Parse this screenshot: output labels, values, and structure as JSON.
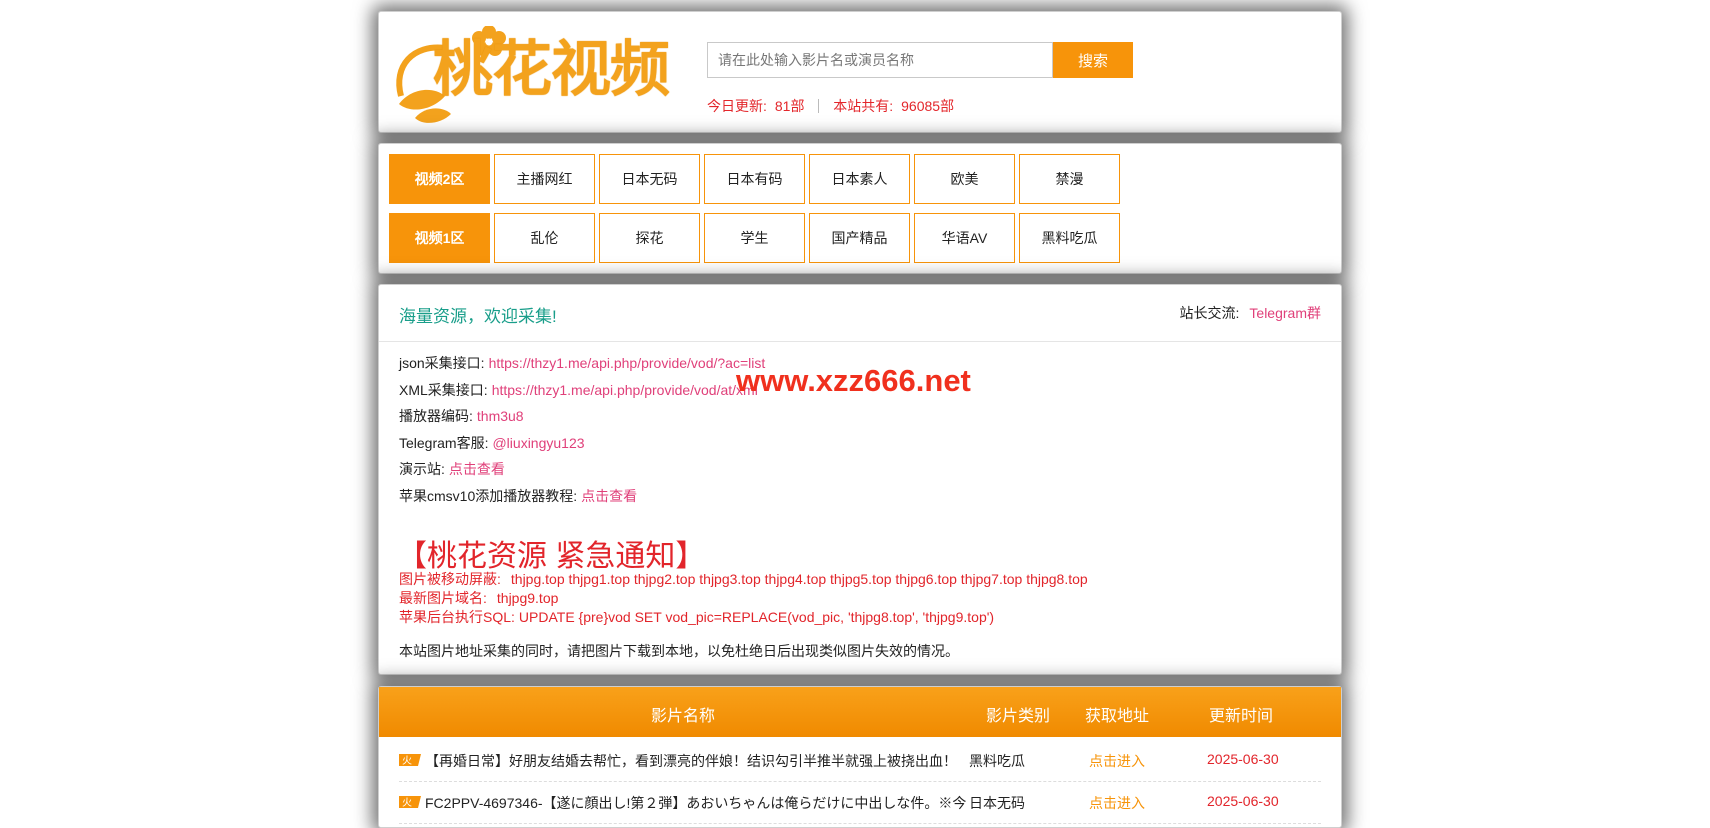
{
  "header": {
    "logo_text": "桃花视频",
    "search_placeholder": "请在此处输入影片名或演员名称",
    "search_button": "搜索",
    "today_label": "今日更新:",
    "today_value": "81部",
    "total_label": "本站共有:",
    "total_value": "96085部"
  },
  "nav": {
    "row1": {
      "head": "视频2区",
      "items": [
        "主播网红",
        "日本无码",
        "日本有码",
        "日本素人",
        "欧美",
        "禁漫"
      ]
    },
    "row2": {
      "head": "视频1区",
      "items": [
        "乱伦",
        "探花",
        "学生",
        "国产精品",
        "华语AV",
        "黑料吃瓜"
      ]
    }
  },
  "notice": {
    "title": "海量资源，欢迎采集!",
    "contact_label": "站长交流:",
    "contact_link": "Telegram群",
    "lines": [
      {
        "label": "json采集接口:",
        "value": "https://thzy1.me/api.php/provide/vod/?ac=list"
      },
      {
        "label": "XML采集接口:",
        "value": "https://thzy1.me/api.php/provide/vod/at/xml"
      },
      {
        "label": "播放器编码:",
        "value": "thm3u8"
      },
      {
        "label": "Telegram客服:",
        "value": "@liuxingyu123"
      },
      {
        "label": "演示站:",
        "value": "点击查看"
      },
      {
        "label": "苹果cmsv10添加播放器教程:",
        "value": "点击查看"
      }
    ],
    "watermark": "www.xzz666.net",
    "urgent_title": "【桃花资源 紧急通知】",
    "red_lines": [
      {
        "label": "图片被移动屏蔽:",
        "value": "thjpg.top thjpg1.top thjpg2.top thjpg3.top thjpg4.top thjpg5.top thjpg6.top thjpg7.top thjpg8.top"
      },
      {
        "label": "最新图片域名:",
        "value": "thjpg9.top"
      },
      {
        "label": "苹果后台执行SQL:",
        "value": "UPDATE {pre}vod SET vod_pic=REPLACE(vod_pic, 'thjpg8.top', 'thjpg9.top')"
      }
    ],
    "footer": "本站图片地址采集的同时，请把图片下载到本地，以免杜绝日后出现类似图片失效的情况。"
  },
  "list": {
    "columns": [
      "影片名称",
      "影片类别",
      "获取地址",
      "更新时间"
    ],
    "rows": [
      {
        "title": "【再婚日常】好朋友结婚去帮忙，看到漂亮的伴娘！结识勾引半推半就强上被挠出血！",
        "category": "黑料吃瓜",
        "link": "点击进入",
        "date": "2025-06-30"
      },
      {
        "title": "FC2PPV-4697346-【遂に顔出し!第２弾】あおいちゃんは俺らだけに中出しな件。※今",
        "category": "日本无码",
        "link": "点击进入",
        "date": "2025-06-30"
      }
    ]
  },
  "colors": {
    "accent": "#f7940a",
    "link_pink": "#e0407a",
    "alert_red": "#e2252b",
    "title_teal": "#199e8a"
  }
}
